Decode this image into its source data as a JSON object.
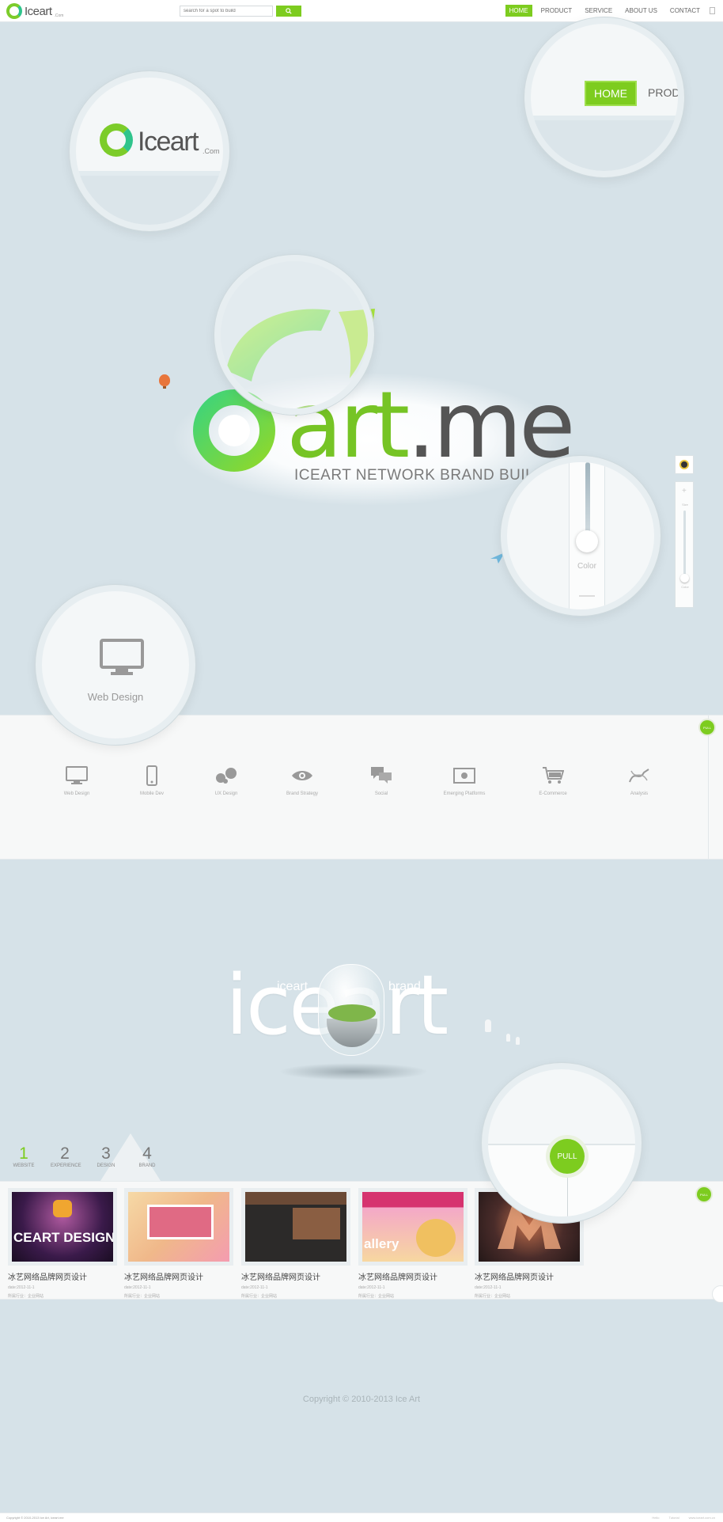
{
  "header": {
    "logo_text": "Iceart",
    "logo_sub": ".Com",
    "search_placeholder": "search for a spot to build",
    "nav": [
      "HOME",
      "PRODUCT",
      "SERVICE",
      "ABOUT US",
      "CONTACT"
    ],
    "active_nav": "HOME"
  },
  "magnifiers": {
    "logo_text": "Iceart",
    "logo_sub": ".Com",
    "nav_home": "HOME",
    "nav_next": "PROD",
    "color_label": "Color",
    "web_label": "Web Design",
    "pull_label": "PULL"
  },
  "hero": {
    "title_prefix": "art",
    "title_suffix": ".me",
    "tagline": "ICEART NETWORK BRAND BUILDI"
  },
  "tools": {
    "label_top": "Size",
    "label_bottom": "Color"
  },
  "services": {
    "pull_label": "PULL",
    "items": [
      {
        "label": "Web Design",
        "icon": "monitor-icon"
      },
      {
        "label": "Mobile Dev",
        "icon": "phone-icon"
      },
      {
        "label": "UX Design",
        "icon": "ux-icon"
      },
      {
        "label": "Brand Strategy",
        "icon": "eye-icon"
      },
      {
        "label": "Social",
        "icon": "chat-icon"
      },
      {
        "label": "Emerging Platforms",
        "icon": "screen-icon"
      },
      {
        "label": "E-Commerce",
        "icon": "cart-icon"
      },
      {
        "label": "Analysis",
        "icon": "analysis-icon"
      }
    ]
  },
  "brand": {
    "word": "iceart",
    "small_left": "iceart",
    "small_right": "brand"
  },
  "steps": [
    {
      "num": "1",
      "label": "WEBSITE"
    },
    {
      "num": "2",
      "label": "EXPERIENCE"
    },
    {
      "num": "3",
      "label": "DESIGN"
    },
    {
      "num": "4",
      "label": "BRAND"
    }
  ],
  "portfolio": {
    "pull_label": "PULL",
    "cards": [
      {
        "title": "冰艺网络品牌网页设计",
        "date": "date:2012-11-1",
        "meta": "所属行业：企业网站",
        "caption": "CEART DESIGN",
        "colors": [
          "#3a1a4a",
          "#8a3a8a"
        ]
      },
      {
        "title": "冰艺网络品牌网页设计",
        "date": "date:2012-11-1",
        "meta": "所属行业：企业网站",
        "caption": "",
        "colors": [
          "#f4c08a",
          "#e97a86"
        ]
      },
      {
        "title": "冰艺网络品牌网页设计",
        "date": "date:2012-11-1",
        "meta": "所属行业：企业网站",
        "caption": "",
        "colors": [
          "#5a3b2a",
          "#2b2a2a"
        ]
      },
      {
        "title": "冰艺网络品牌网页设计",
        "date": "date:2012-11-1",
        "meta": "所属行业：企业网站",
        "caption": "allery",
        "colors": [
          "#e8508e",
          "#f0c060"
        ]
      },
      {
        "title": "冰艺网络品牌网页设计",
        "date": "date:2012-11-1",
        "meta": "所属行业：企业网站",
        "caption": "",
        "colors": [
          "#3a2a2a",
          "#c06a4a"
        ]
      }
    ]
  },
  "copyright": "Copyright © 2010-2013 Ice Art",
  "footer": {
    "left": "Copyright © 2010-2013 Ice Art, iceart.me",
    "right": [
      "Hello",
      "Tutorial",
      "www.iceart.com.cn"
    ]
  },
  "colors": {
    "accent": "#7dcc1f",
    "background": "#d6e2e8"
  }
}
